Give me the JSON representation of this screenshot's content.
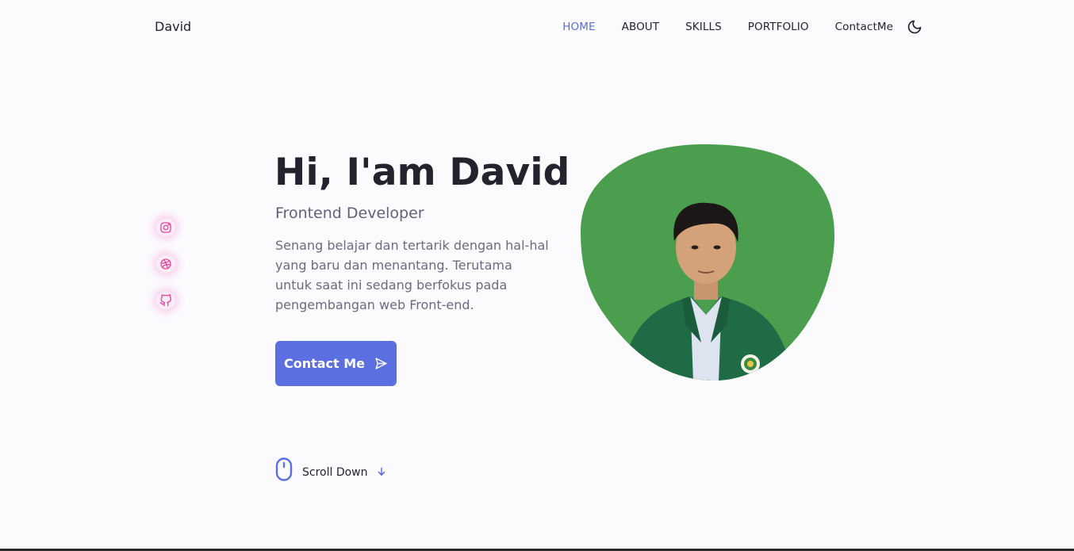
{
  "header": {
    "logo": "David",
    "nav": [
      {
        "label": "HOME",
        "active": true
      },
      {
        "label": "ABOUT",
        "active": false
      },
      {
        "label": "SKILLS",
        "active": false
      },
      {
        "label": "PORTFOLIO",
        "active": false
      },
      {
        "label": "ContactMe",
        "active": false
      }
    ],
    "theme_icon": "moon-icon"
  },
  "social": [
    {
      "icon": "instagram-icon"
    },
    {
      "icon": "dribbble-icon"
    },
    {
      "icon": "github-icon"
    }
  ],
  "hero": {
    "title": "Hi, I'am David",
    "subtitle": "Frontend Developer",
    "description": "Senang belajar dan tertarik dengan hal-hal yang baru dan menantang. Terutama untuk saat ini sedang berfokus pada pengembangan web Front-end.",
    "button_label": "Contact Me",
    "button_icon": "send-icon",
    "image_icon": "profile-photo"
  },
  "scroll": {
    "label": "Scroll Down",
    "mouse_icon": "mouse-icon",
    "arrow_icon": "arrow-down-icon"
  },
  "colors": {
    "accent": "#5b6fe0",
    "blob": "#4a9e4e",
    "social_glow": "#f678c8",
    "text_dark": "#23232e",
    "text_muted": "#6b6b80"
  }
}
